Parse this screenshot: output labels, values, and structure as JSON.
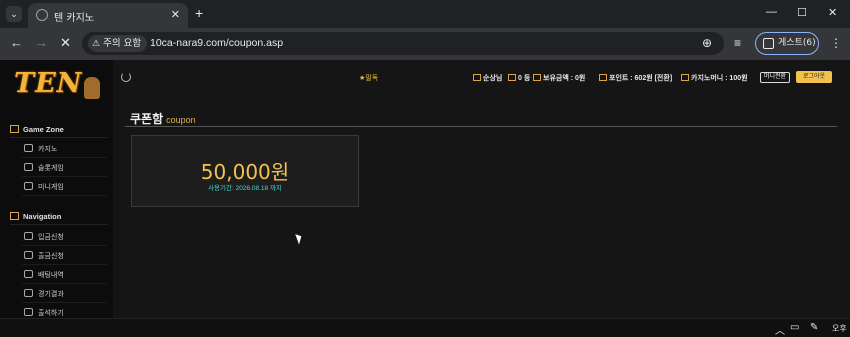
{
  "browser": {
    "tab_title": "텐 카지노",
    "security_label": "주의 요함",
    "url": "10ca-nara9.com/coupon.asp",
    "profile_label": "게스트(6)"
  },
  "site": {
    "logo": "TEN",
    "sidebar": {
      "game_zone_label": "Game Zone",
      "game_items": [
        "카지노",
        "슬롯게임",
        "미니게임"
      ],
      "navigation_label": "Navigation",
      "nav_items": [
        "입금신청",
        "출금신청",
        "배팅내역",
        "경기결과",
        "출석하기"
      ]
    },
    "topbar": {
      "notice": "★필독",
      "user": "순상님",
      "user_level": "0 등",
      "balance": "보유금액 : 0원",
      "points": "포인트 : 602원 [전환]",
      "casino_mini": "카지노머니 : 100원",
      "mini_button": "머니전환",
      "logout_button": "로그아웃"
    },
    "coupon_box": {
      "title": "쿠폰함",
      "subtitle": "coupon",
      "coupons": [
        {
          "label": "",
          "amount": "50,000원",
          "period": "사용기간: 2026.08.18 까지"
        }
      ]
    }
  },
  "taskbar": {
    "clock": "오후"
  }
}
